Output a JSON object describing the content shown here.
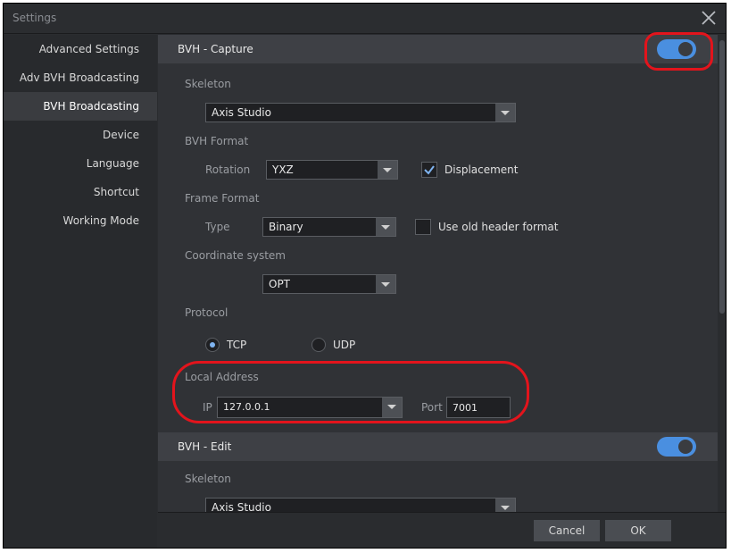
{
  "window": {
    "title": "Settings"
  },
  "sidebar": {
    "items": [
      {
        "label": "Advanced Settings"
      },
      {
        "label": "Adv BVH Broadcasting"
      },
      {
        "label": "BVH Broadcasting",
        "active": true
      },
      {
        "label": "Device"
      },
      {
        "label": "Language"
      },
      {
        "label": "Shortcut"
      },
      {
        "label": "Working Mode"
      }
    ]
  },
  "capture": {
    "title": "BVH - Capture",
    "enabled": true,
    "skeleton_label": "Skeleton",
    "skeleton_value": "Axis Studio",
    "bvh_format_label": "BVH Format",
    "rotation_label": "Rotation",
    "rotation_value": "YXZ",
    "displacement_label": "Displacement",
    "displacement_checked": true,
    "frame_format_label": "Frame Format",
    "type_label": "Type",
    "type_value": "Binary",
    "old_header_label": "Use old header format",
    "old_header_checked": false,
    "coord_label": "Coordinate system",
    "coord_value": "OPT",
    "protocol_label": "Protocol",
    "tcp_label": "TCP",
    "udp_label": "UDP",
    "protocol_selected": "TCP",
    "local_address_label": "Local Address",
    "ip_label": "IP",
    "ip_value": "127.0.0.1",
    "port_label": "Port",
    "port_value": "7001"
  },
  "edit": {
    "title": "BVH - Edit",
    "enabled": true,
    "skeleton_label": "Skeleton",
    "skeleton_value": "Axis Studio"
  },
  "footer": {
    "cancel_label": "Cancel",
    "ok_label": "OK"
  },
  "colors": {
    "accent": "#4a8fe0",
    "highlight": "#e3141c",
    "background": "#303236"
  }
}
